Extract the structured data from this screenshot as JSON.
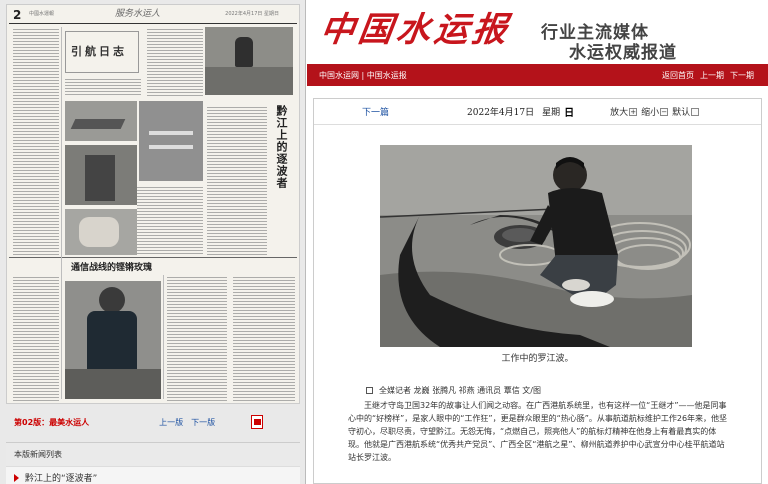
{
  "left": {
    "page_number": "2",
    "scan_header_text": "中國水運報",
    "scan_header_calligraphy": "服务水运人",
    "scan_date_text": "2022年4月17日 星期日",
    "scan_column_title": "引航日志",
    "scan_vertical_title": "黔江上的逐波者",
    "scan_wide_title": "通信战线的铿锵玫瑰",
    "edition_label": "第02版：最美水运人",
    "nav_prev": "上一版",
    "nav_next": "下一版",
    "news_list_title": "本版新闻列表",
    "news_items": [
      "黔江上的“逐波者”"
    ]
  },
  "banner": {
    "logo": "中国水运报",
    "slogan_line1": "行业主流媒体",
    "slogan_line2": "水运权威报道",
    "brand_red": "#b4121a"
  },
  "nav": {
    "site_links": "中国水运网 | 中国水运报",
    "home": "返回首页",
    "prev_edition": "上一期",
    "next_edition": "下一期"
  },
  "toolbar": {
    "next_article": "下一篇",
    "date": "2022年4月17日",
    "weekday": "星期",
    "weekday_day": "日",
    "zoom_in": "放大",
    "zoom_in_icon": "+",
    "zoom_out": "缩小",
    "zoom_out_icon": "−",
    "zoom_default": "默认"
  },
  "article": {
    "photo_caption": "工作中的罗江波。",
    "byline": "全媒记者 龙巍 张腾凡 祁燕 通讯员 覃信 文/图",
    "body": "王继才守岛卫国32年的故事让人们闻之动容。在广西港航系统里，也有这样一位“王继才”——他是同事心中的“好榜样”，是家人眼中的“工作狂”，更是群众眼里的“热心肠”。从事航道航标维护工作26年来，他坚守初心，尽职尽责，守望黔江。无怨无悔，“点燃自己，照亮他人”的航标灯精神在他身上有着最真实的体现。他就是广西港航系统“优秀共产党员”、广西全区“港航之星”、柳州航道养护中心武宣分中心桂平航道站站长罗江波。"
  }
}
